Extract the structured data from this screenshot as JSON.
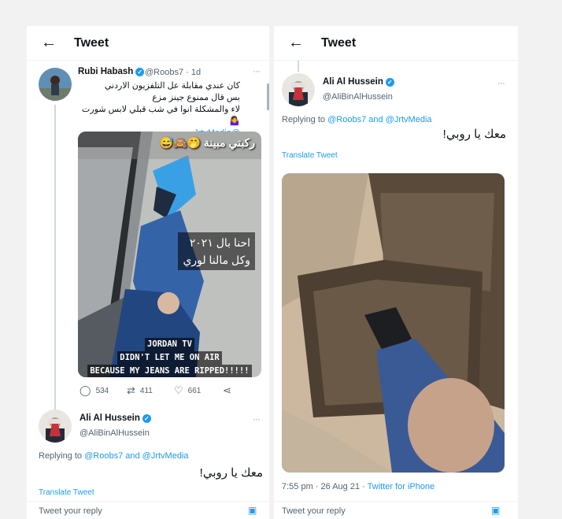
{
  "left": {
    "header": {
      "back": "←",
      "title": "Tweet"
    },
    "tweet1": {
      "name": "Rubi Habash",
      "handle": "@Roobs7 · 1d",
      "text": [
        "كان عندي مقابلة عل التلفزيون الاردني",
        "بس قال ممنوع جينز مزع",
        "لاء والمشكلة انوا في شب قبلي لابس شورت 🤷‍♀️"
      ],
      "mention": "@JrtvMedia",
      "image_overlay": {
        "top": "ركبتي مبينة 🤭🙈😅",
        "middle": [
          "احنا بال ٢٠٢١",
          "وكل مالنا لوري"
        ],
        "bottom": [
          "JORDAN TV",
          "DIDN'T LET ME ON AIR",
          "BECAUSE MY JEANS ARE RIPPED!!!!!"
        ]
      },
      "replies": "534",
      "retweets": "411",
      "likes": "661"
    },
    "tweet2": {
      "name": "Ali Al Hussein",
      "handle": "@AliBinAlHussein",
      "replying_prefix": "Replying to",
      "replying_to": "@Roobs7 and @JrtvMedia",
      "text": "معك يا روبي!",
      "translate": "Translate Tweet",
      "reply_placeholder": "Tweet your reply"
    }
  },
  "right": {
    "header": {
      "back": "←",
      "title": "Tweet"
    },
    "tweet": {
      "name": "Ali Al Hussein",
      "handle": "@AliBinAlHussein",
      "replying_prefix": "Replying to",
      "replying_to": "@Roobs7 and @JrtvMedia",
      "text": "معك يا روبي!",
      "translate": "Translate Tweet",
      "timestamp": "7:55 pm · 26 Aug 21 · ",
      "source": "Twitter for iPhone",
      "reply_placeholder": "Tweet your reply"
    }
  },
  "colors": {
    "accent": "#1d9bf0",
    "muted": "#536471"
  }
}
